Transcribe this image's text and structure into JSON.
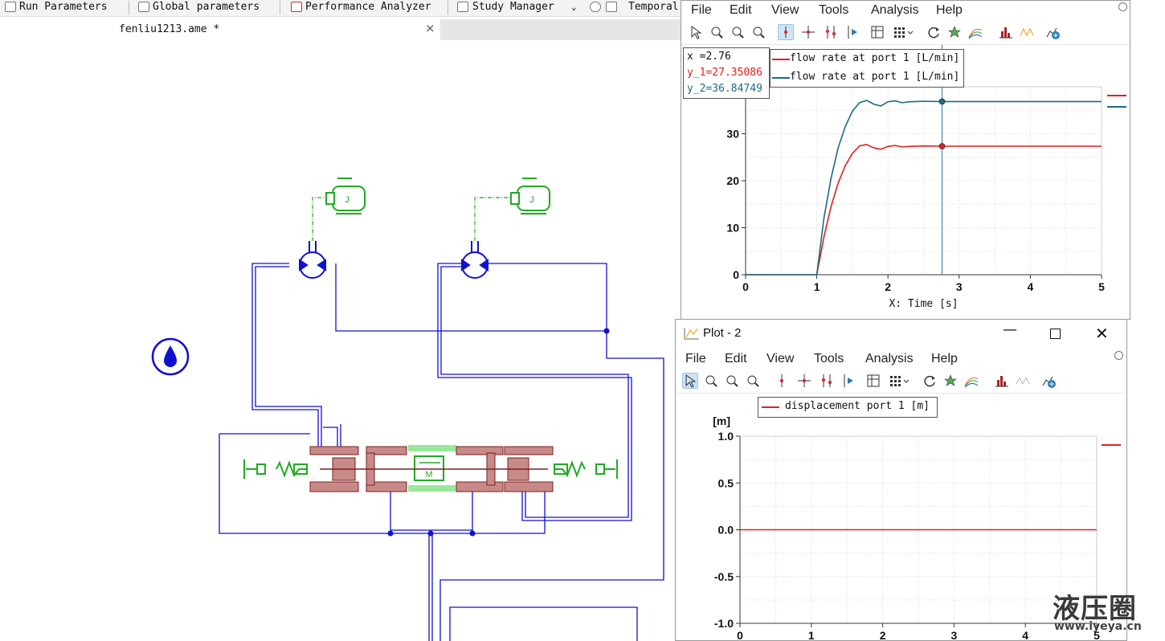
{
  "toolbar": {
    "items": [
      "Run Parameters",
      "Global parameters",
      "Performance Analyzer",
      "Study Manager",
      "Temporal"
    ]
  },
  "document": {
    "tab_title": "fenliu1213.ame *",
    "close_glyph": "×"
  },
  "plot1": {
    "menu": [
      "File",
      "Edit",
      "View",
      "Tools",
      "Analysis",
      "Help"
    ],
    "readout": {
      "x": "x  =2.76",
      "y1": "y_1=27.35086",
      "y2": "y_2=36.84749"
    },
    "legend": [
      "flow rate at port 1 [L/min]",
      "flow rate at port 1 [L/min]"
    ],
    "colors": {
      "series1": "#e02020",
      "series2": "#1b6a86",
      "cursor": "#2a7bb0"
    }
  },
  "plot2": {
    "title": "Plot - 2",
    "menu": [
      "File",
      "Edit",
      "View",
      "Tools",
      "Analysis",
      "Help"
    ],
    "legend": [
      "displacement port 1 [m]"
    ],
    "colors": {
      "series1": "#e02020"
    }
  },
  "chart_data": [
    {
      "type": "line",
      "xlabel": "X: Time [s]",
      "ylabel": "",
      "xlim": [
        0,
        5
      ],
      "ylim": [
        0,
        40
      ],
      "xticks": [
        "0",
        "1",
        "2",
        "3",
        "4",
        "5"
      ],
      "yticks": [
        "0",
        "10",
        "20",
        "30"
      ],
      "grid": true,
      "legend_position": "top-left",
      "cursor_x": 2.76,
      "series": [
        {
          "name": "flow rate at port 1 [L/min]",
          "color": "#e02020",
          "x": [
            0,
            1.0,
            1.05,
            1.1,
            1.2,
            1.3,
            1.4,
            1.5,
            1.6,
            1.7,
            1.8,
            1.9,
            2.0,
            2.1,
            2.2,
            2.3,
            2.5,
            2.76,
            3.0,
            3.5,
            4.0,
            4.5,
            5.0
          ],
          "y": [
            0,
            0,
            4,
            8,
            14.5,
            19.5,
            23.2,
            25.8,
            27.4,
            27.7,
            27.0,
            26.7,
            27.3,
            27.5,
            27.2,
            27.3,
            27.4,
            27.35,
            27.35,
            27.35,
            27.35,
            27.35,
            27.35
          ]
        },
        {
          "name": "flow rate at port 1 [L/min]",
          "color": "#1b6a86",
          "x": [
            0,
            1.0,
            1.05,
            1.1,
            1.2,
            1.3,
            1.4,
            1.5,
            1.6,
            1.7,
            1.8,
            1.9,
            2.0,
            2.1,
            2.2,
            2.3,
            2.5,
            2.76,
            3.0,
            3.5,
            4.0,
            4.5,
            5.0
          ],
          "y": [
            0,
            0,
            6,
            12,
            20.5,
            27,
            31.5,
            34.8,
            36.6,
            37.1,
            36.3,
            35.9,
            36.8,
            37.0,
            36.6,
            36.8,
            36.9,
            36.85,
            36.85,
            36.85,
            36.85,
            36.85,
            36.85
          ]
        }
      ]
    },
    {
      "type": "line",
      "xlabel": "",
      "ylabel": "[m]",
      "xlim": [
        0,
        5
      ],
      "ylim": [
        -1.0,
        1.0
      ],
      "xticks": [
        "0",
        "1",
        "2",
        "3",
        "4",
        "5"
      ],
      "yticks": [
        "1.0",
        "0.5",
        "0.0",
        "-0.5",
        "-1.0"
      ],
      "grid": true,
      "legend_position": "top-left",
      "series": [
        {
          "name": "displacement port 1 [m]",
          "color": "#e02020",
          "x": [
            0,
            5
          ],
          "y": [
            0,
            0
          ]
        }
      ]
    }
  ],
  "watermark": {
    "text_cn": "液压圈",
    "url": "www.iyeya.cn"
  }
}
